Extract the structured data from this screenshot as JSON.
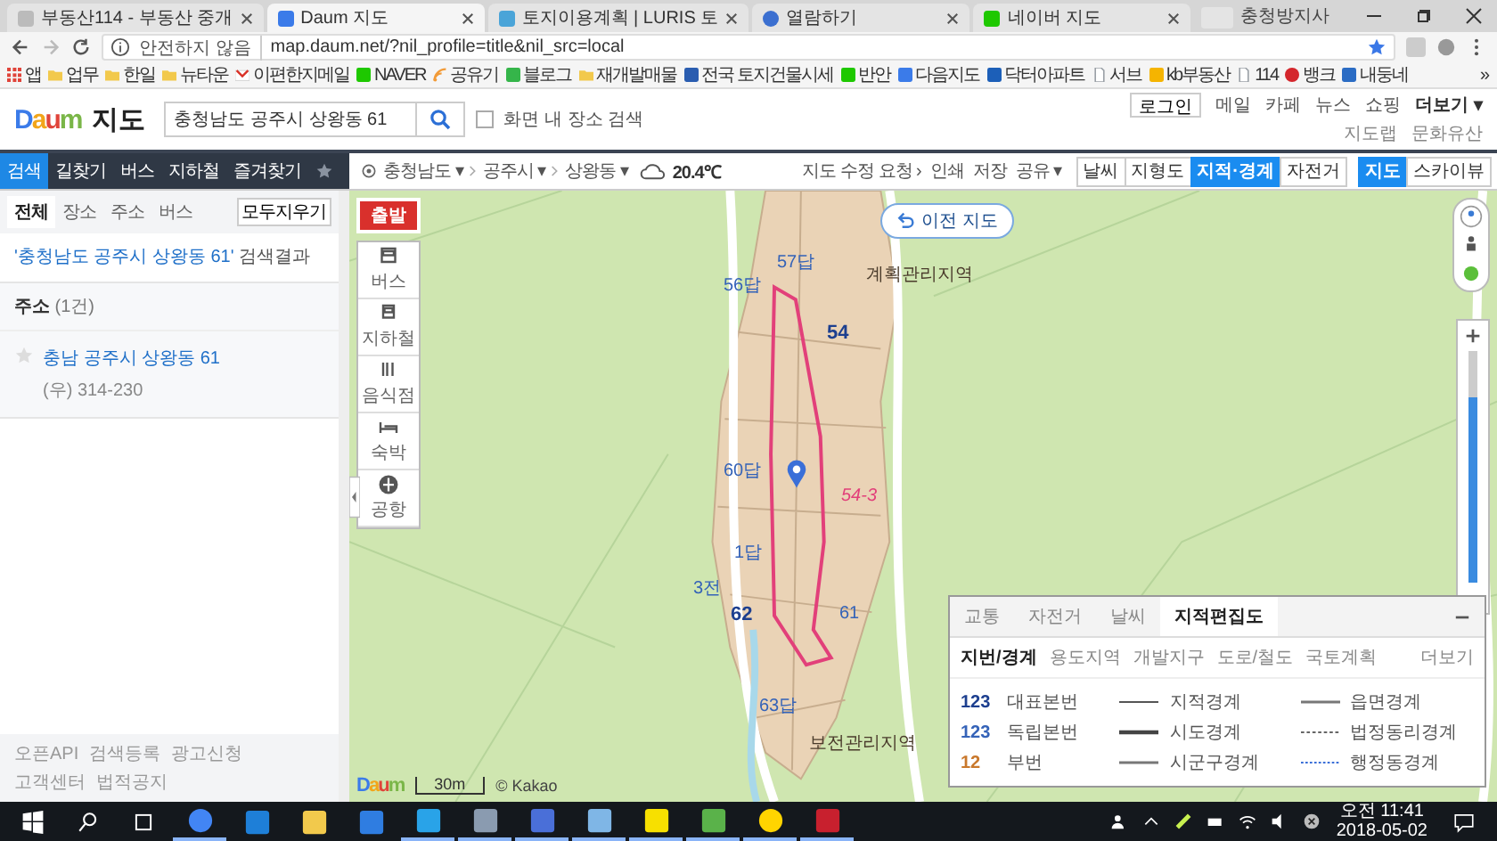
{
  "browser": {
    "tabs": [
      {
        "title": "부동산114 - 부동산 중개",
        "selected": false
      },
      {
        "title": "Daum 지도",
        "selected": true
      },
      {
        "title": "토지이용계획 | LURIS 토",
        "selected": false
      },
      {
        "title": "열람하기",
        "selected": false
      },
      {
        "title": "네이버 지도",
        "selected": false
      }
    ],
    "profile": "충청방지사",
    "security": "안전하지 않음",
    "url": "map.daum.net/?nil_profile=title&nil_src=local",
    "bookmarks": [
      {
        "label": "앱"
      },
      {
        "label": "업무"
      },
      {
        "label": "한일"
      },
      {
        "label": "뉴타운"
      },
      {
        "label": "이편한지메일"
      },
      {
        "label": "NAVER"
      },
      {
        "label": "공유기"
      },
      {
        "label": "블로그"
      },
      {
        "label": "재개발매물"
      },
      {
        "label": "전국 토지건물시세"
      },
      {
        "label": "반안"
      },
      {
        "label": "다음지도"
      },
      {
        "label": "닥터아파트"
      },
      {
        "label": "서브"
      },
      {
        "label": "kb부동산"
      },
      {
        "label": "114"
      },
      {
        "label": "뱅크"
      },
      {
        "label": "내둥네"
      }
    ],
    "bookmarks_more": "»"
  },
  "header": {
    "logo": "Daum",
    "service": "지도",
    "search": {
      "value": "충청남도 공주시 상왕동 61"
    },
    "scope_checkbox": {
      "label": "화면 내 장소 검색",
      "checked": false
    },
    "links": [
      {
        "label": "로그인",
        "kind": "button"
      },
      {
        "label": "메일",
        "kind": "link"
      },
      {
        "label": "카페",
        "kind": "link"
      },
      {
        "label": "뉴스",
        "kind": "link"
      },
      {
        "label": "쇼핑",
        "kind": "link"
      },
      {
        "label": "더보기 ▾",
        "kind": "strong"
      }
    ],
    "sub_links": [
      "지도랩",
      "문화유산"
    ]
  },
  "nav": {
    "tabs": [
      {
        "label": "검색",
        "selected": true
      },
      {
        "label": "길찾기",
        "selected": false
      },
      {
        "label": "버스",
        "selected": false
      },
      {
        "label": "지하철",
        "selected": false
      },
      {
        "label": "즐겨찾기",
        "selected": false
      }
    ]
  },
  "toolbar": {
    "breadcrumb": [
      "충청남도 ▾",
      "공주시 ▾",
      "상왕동 ▾"
    ],
    "temperature": "20.4℃",
    "actions": [
      "지도 수정 요청 ›",
      "인쇄",
      "저장",
      "공유 ▾"
    ],
    "layers": [
      {
        "label": "날씨",
        "on": false
      },
      {
        "label": "지형도",
        "on": false
      },
      {
        "label": "지적·경계",
        "on": true
      },
      {
        "label": "자전거",
        "on": false
      }
    ],
    "map_types": [
      {
        "label": "지도",
        "selected": true
      },
      {
        "label": "스카이뷰",
        "selected": false
      }
    ]
  },
  "panel": {
    "tabs": [
      {
        "label": "전체",
        "selected": true
      },
      {
        "label": "장소",
        "selected": false
      },
      {
        "label": "주소",
        "selected": false
      },
      {
        "label": "버스",
        "selected": false
      }
    ],
    "clear_button": "모두지우기",
    "query": "'충청남도 공주시 상왕동 61'",
    "query_suffix": "검색결과",
    "section": {
      "title": "주소",
      "count": "(1건)"
    },
    "results": [
      {
        "name": "충남 공주시 상왕동 61",
        "postcode": "(우) 314-230"
      }
    ],
    "footer": [
      "오픈API",
      "검색등록",
      "광고신청",
      "고객센터",
      "법적공지"
    ]
  },
  "map": {
    "start_label": "출발",
    "tools": [
      {
        "label": "버스",
        "kind": "bus"
      },
      {
        "label": "지하철",
        "kind": "train"
      },
      {
        "label": "음식점",
        "kind": "food"
      },
      {
        "label": "숙박",
        "kind": "bed"
      },
      {
        "label": "공항",
        "kind": "plane"
      }
    ],
    "back_button": "이전 지도",
    "labels": [
      {
        "text": "57답",
        "kind": "lot"
      },
      {
        "text": "계획관리지역",
        "kind": "zone"
      },
      {
        "text": "56답",
        "kind": "lot"
      },
      {
        "text": "54",
        "kind": "main"
      },
      {
        "text": "60답",
        "kind": "lot"
      },
      {
        "text": "54-3",
        "kind": "note"
      },
      {
        "text": "1답",
        "kind": "lot"
      },
      {
        "text": "3전",
        "kind": "lot"
      },
      {
        "text": "62",
        "kind": "main"
      },
      {
        "text": "61",
        "kind": "lot"
      },
      {
        "text": "63답",
        "kind": "lot"
      },
      {
        "text": "보전관리지역",
        "kind": "zone"
      }
    ],
    "zoom_slider": {
      "level": 0.8
    },
    "logo": "Daum",
    "scale": "30m",
    "copyright": "© Kakao",
    "legend": {
      "tabs": [
        {
          "label": "교통",
          "selected": false
        },
        {
          "label": "자전거",
          "selected": false
        },
        {
          "label": "날씨",
          "selected": false
        },
        {
          "label": "지적편집도",
          "selected": true
        }
      ],
      "subtabs": [
        {
          "label": "지번/경계",
          "selected": true
        },
        {
          "label": "용도지역",
          "selected": false
        },
        {
          "label": "개발지구",
          "selected": false
        },
        {
          "label": "도로/철도",
          "selected": false
        },
        {
          "label": "국토계획",
          "selected": false
        }
      ],
      "more": "더보기",
      "numbers": [
        {
          "number": "123",
          "label": "대표본번",
          "color": "#1d3f8f"
        },
        {
          "number": "123",
          "label": "독립본번",
          "color": "#3563b8"
        },
        {
          "number": "12",
          "label": "부번",
          "color": "#c9782c"
        }
      ],
      "boundaries": [
        {
          "label": "지적경계",
          "kind": "thin"
        },
        {
          "label": "시도경계",
          "kind": "thick"
        },
        {
          "label": "시군구경계",
          "kind": "medium"
        },
        {
          "label": "읍면경계",
          "kind": "medium"
        },
        {
          "label": "법정동리경계",
          "kind": "dashed"
        },
        {
          "label": "행정동경계",
          "kind": "dotted"
        }
      ]
    }
  },
  "taskbar": {
    "apps": [
      {
        "kind": "chrome",
        "active": true
      },
      {
        "kind": "edge",
        "active": false
      },
      {
        "kind": "folder",
        "active": false
      },
      {
        "kind": "store",
        "active": false
      },
      {
        "kind": "ie",
        "active": true
      },
      {
        "kind": "photo",
        "active": true
      },
      {
        "kind": "floppy",
        "active": true
      },
      {
        "kind": "notepad",
        "active": true
      },
      {
        "kind": "chat",
        "active": true
      },
      {
        "kind": "tile",
        "active": true
      },
      {
        "kind": "circle",
        "active": true
      },
      {
        "kind": "shield",
        "active": true
      }
    ],
    "time": "오전 11:41",
    "date": "2018-05-02"
  }
}
